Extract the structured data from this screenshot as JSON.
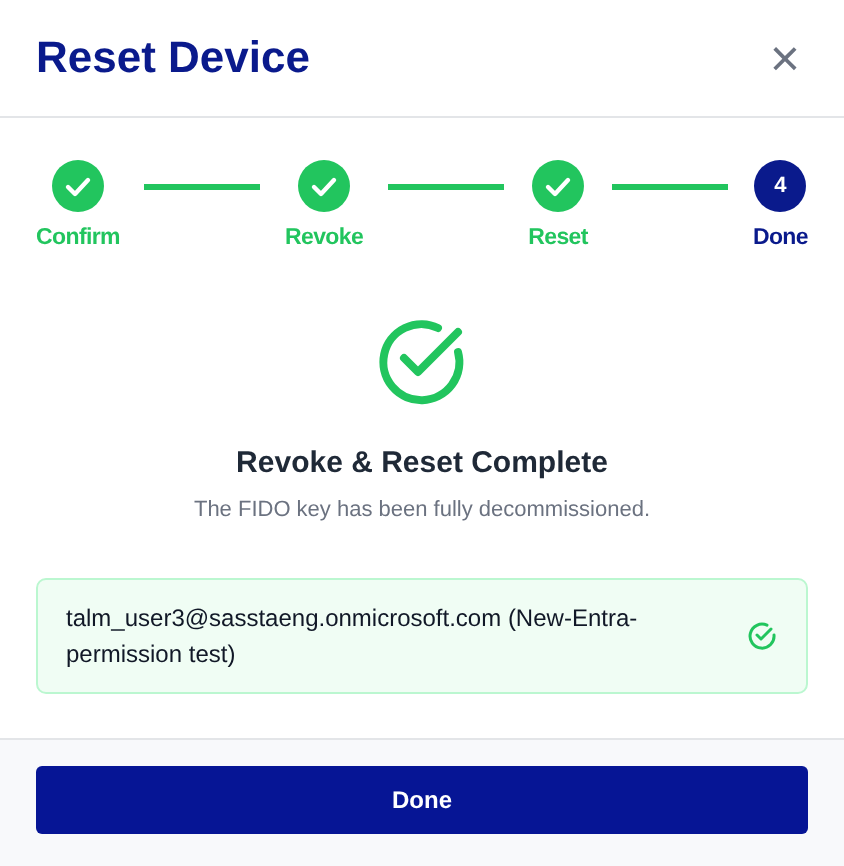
{
  "dialog": {
    "title": "Reset Device",
    "close": "×"
  },
  "steps": [
    {
      "label": "Confirm",
      "completed": true,
      "selected": false
    },
    {
      "label": "Revoke",
      "completed": true,
      "selected": false
    },
    {
      "label": "Reset",
      "completed": true,
      "selected": false
    },
    {
      "label": "Done",
      "completed": false,
      "selected": true,
      "number": "4"
    }
  ],
  "result": {
    "heading": "Revoke & Reset Complete",
    "message": "The FIDO key has been fully decommissioned."
  },
  "devices": [
    {
      "text": "talm_user3@sasstaeng.onmicrosoft.com (New-Entra-permission test)",
      "verified": true
    }
  ],
  "footer": {
    "button": "Done"
  }
}
